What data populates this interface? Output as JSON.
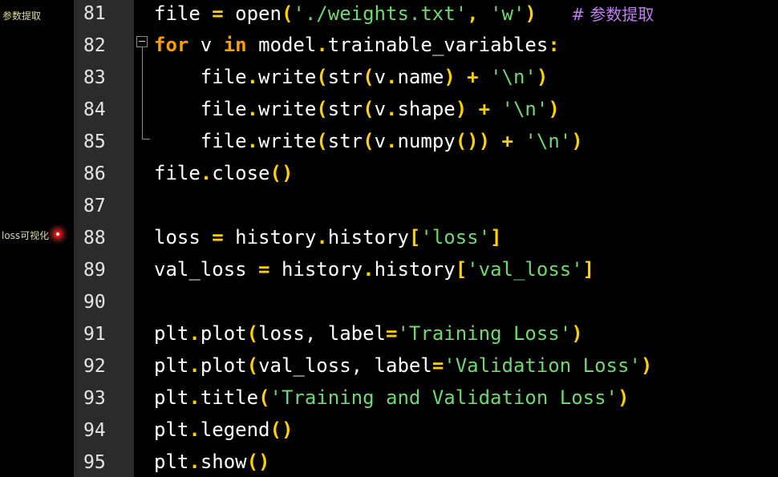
{
  "annotations": {
    "params_note": "参数提取",
    "loss_note": "loss可视化"
  },
  "editor": {
    "lines": [
      {
        "number": "81",
        "tokens": [
          "file",
          " = ",
          "open",
          "(",
          "'./weights.txt'",
          ", ",
          "'w'",
          ")",
          "   ",
          "# 参数提取"
        ]
      },
      {
        "number": "82",
        "tokens": [
          "for",
          " v ",
          "in",
          " model",
          ".",
          "trainable_variables",
          ":"
        ]
      },
      {
        "number": "83",
        "tokens": [
          "    file",
          ".",
          "write",
          "(",
          "str",
          "(",
          "v",
          ".",
          "name",
          ")",
          " + ",
          "'\\n'",
          ")"
        ]
      },
      {
        "number": "84",
        "tokens": [
          "    file",
          ".",
          "write",
          "(",
          "str",
          "(",
          "v",
          ".",
          "shape",
          ")",
          " + ",
          "'\\n'",
          ")"
        ]
      },
      {
        "number": "85",
        "tokens": [
          "    file",
          ".",
          "write",
          "(",
          "str",
          "(",
          "v",
          ".",
          "numpy",
          "())",
          " + ",
          "'\\n'",
          ")"
        ]
      },
      {
        "number": "86",
        "tokens": [
          "file",
          ".",
          "close",
          "()"
        ]
      },
      {
        "number": "87",
        "tokens": []
      },
      {
        "number": "88",
        "tokens": [
          "loss",
          " = ",
          "history",
          ".",
          "history",
          "[",
          "'loss'",
          "]"
        ]
      },
      {
        "number": "89",
        "tokens": [
          "val_loss",
          " = ",
          "history",
          ".",
          "history",
          "[",
          "'val_loss'",
          "]"
        ]
      },
      {
        "number": "90",
        "tokens": []
      },
      {
        "number": "91",
        "tokens": [
          "plt",
          ".",
          "plot",
          "(",
          "loss, label",
          "=",
          "'Training Loss'",
          ")"
        ]
      },
      {
        "number": "92",
        "tokens": [
          "plt",
          ".",
          "plot",
          "(",
          "val_loss, label",
          "=",
          "'Validation Loss'",
          ")"
        ]
      },
      {
        "number": "93",
        "tokens": [
          "plt",
          ".",
          "title",
          "(",
          "'Training and Validation Loss'",
          ")"
        ]
      },
      {
        "number": "94",
        "tokens": [
          "plt",
          ".",
          "legend",
          "()"
        ]
      },
      {
        "number": "95",
        "tokens": [
          "plt",
          ".",
          "show",
          "()"
        ]
      }
    ]
  },
  "colors": {
    "background": "#000000",
    "gutter": "#2b2b2b",
    "keyword": "#ff9d00",
    "punctuation": "#ffd000",
    "string": "#6fd96f",
    "comment": "#c27cf7",
    "identifier": "#ffffff",
    "annotation": "#dcdcaa",
    "marker": "#e01010"
  },
  "icons": {
    "fold": "fold-minus-icon",
    "bookmark": "bookmark-dot-icon"
  }
}
